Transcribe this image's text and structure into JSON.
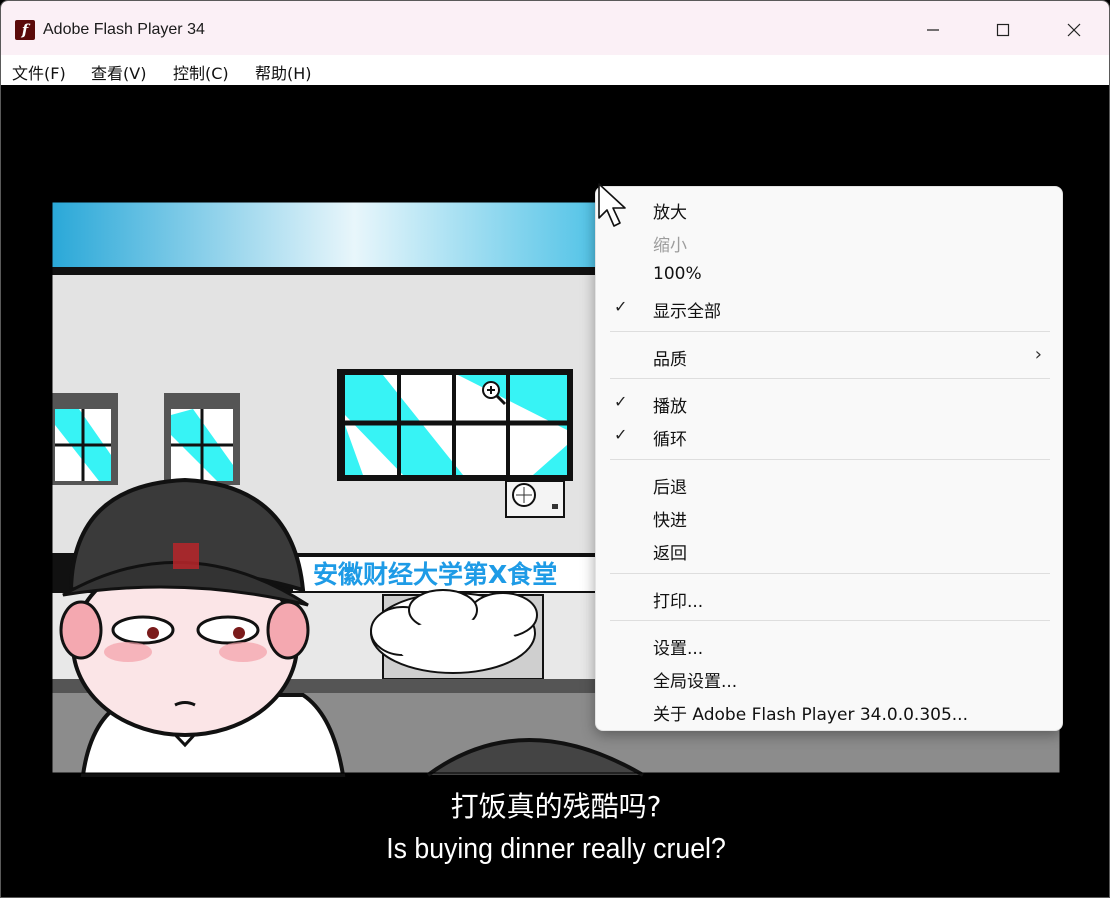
{
  "window": {
    "title": "Adobe Flash Player 34",
    "app_icon_glyph": "f"
  },
  "menubar": {
    "items": [
      "文件(F)",
      "查看(V)",
      "控制(C)",
      "帮助(H)"
    ]
  },
  "scene": {
    "sign_text": "安徽财经大学第X食堂"
  },
  "subtitles": {
    "chinese": "打饭真的残酷吗?",
    "english": "Is buying dinner really cruel?"
  },
  "context_menu": {
    "zoom_in": "放大",
    "zoom_out": "缩小",
    "zoom_100": "100%",
    "show_all": "显示全部",
    "quality": "品质",
    "play": "播放",
    "loop": "循环",
    "back": "后退",
    "forward": "快进",
    "return": "返回",
    "print": "打印...",
    "settings": "设置...",
    "global_settings": "全局设置...",
    "about": "关于 Adobe Flash Player 34.0.0.305...",
    "check_glyph": "✓",
    "submenu_glyph": "›"
  },
  "colors": {
    "titlebar_bg": "#fbf0f6",
    "sky": "#29b1de",
    "window_glass": "#37f3f5",
    "sign_text": "#1e9be6",
    "menu_bg": "#f9f9f9"
  }
}
